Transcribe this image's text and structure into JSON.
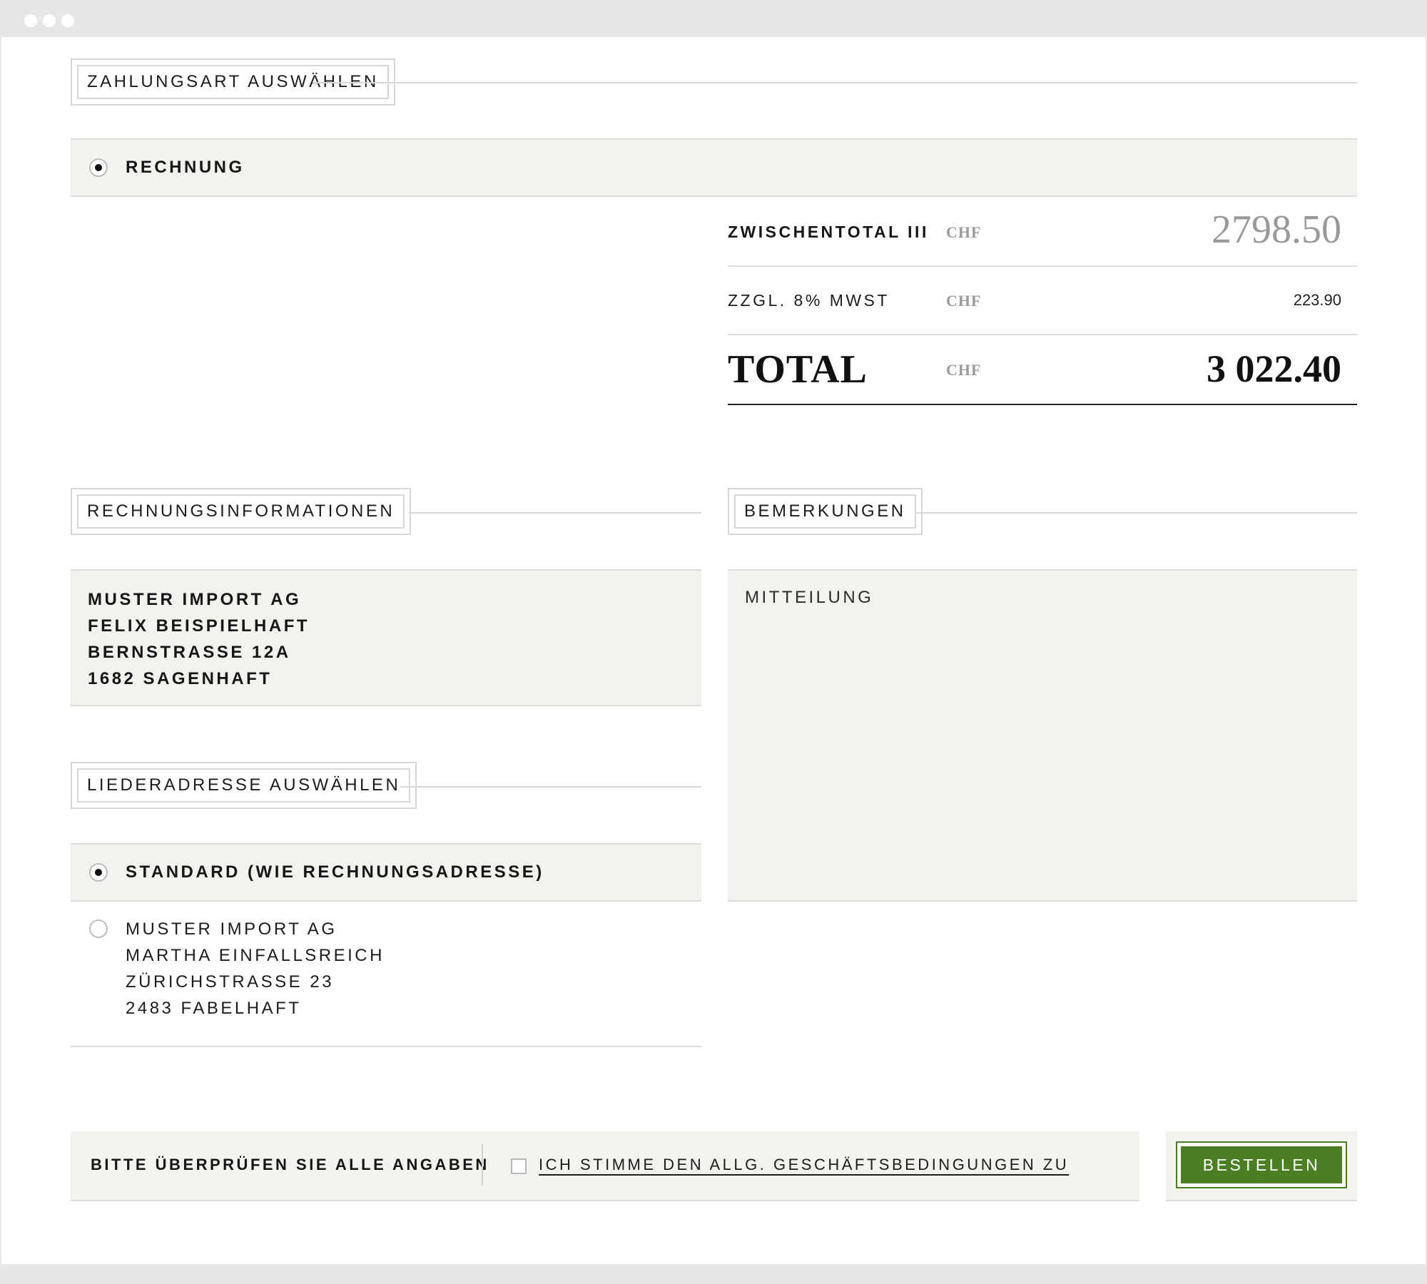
{
  "payment": {
    "section_title": "Zahlungsart auswählen",
    "option_label": "Rechnung",
    "option_selected": true
  },
  "summary": {
    "subtotal_label": "Zwischentotal III",
    "subtotal_currency": "CHF",
    "subtotal_value": "2798.50",
    "vat_label": "zzgl. 8% MWST",
    "vat_currency": "CHF",
    "vat_value": "223.90",
    "total_label": "TOTAL",
    "total_currency": "CHF",
    "total_value": "3 022.40"
  },
  "billing": {
    "section_title": "Rechnungsinformationen",
    "lines": [
      "Muster Import AG",
      "Felix Beispielhaft",
      "Bernstrasse 12A",
      "1682 Sagenhaft"
    ]
  },
  "remarks": {
    "section_title": "Bemerkungen",
    "placeholder": "Mitteilung"
  },
  "delivery": {
    "section_title": "Liederadresse auswählen",
    "standard_label": "Standard (wie Rechnungsadresse)",
    "standard_selected": true,
    "alternative_lines": [
      "Muster Import AG",
      "Martha Einfallsreich",
      "Zürichstrasse 23",
      "2483 Fabelhaft"
    ],
    "alternative_selected": false
  },
  "footer": {
    "check_notice": "Bitte überprüfen Sie alle Angaben",
    "terms_label": "Ich stimme den allg. Geschäftsbedingungen zu",
    "terms_checked": false,
    "order_button": "Bestellen"
  },
  "colors": {
    "accent_green": "#4c7f24",
    "band_background": "#f3f2ef",
    "muted_text": "#9b9b9b"
  }
}
